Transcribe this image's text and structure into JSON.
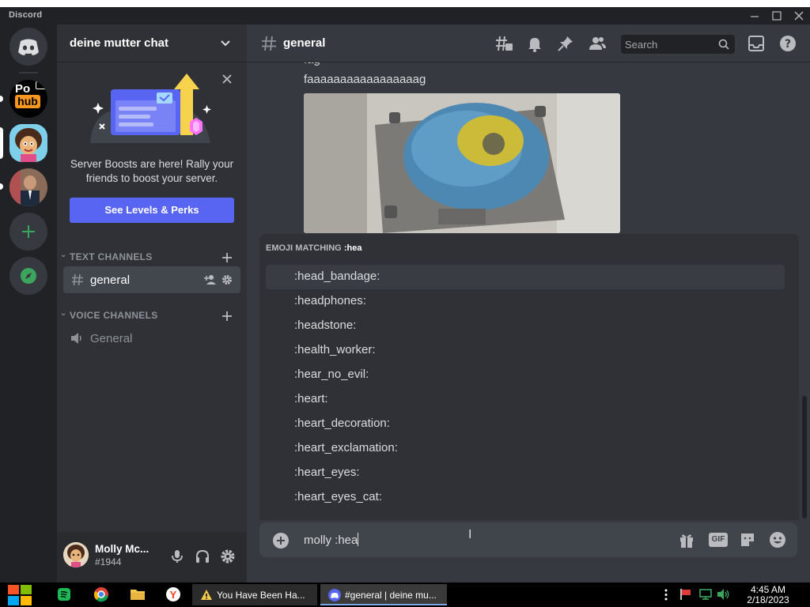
{
  "app": {
    "title": "Discord"
  },
  "server": {
    "name": "deine mutter chat",
    "boost": {
      "text": "Server Boosts are here! Rally your friends to boost your server.",
      "button_label": "See Levels & Perks"
    }
  },
  "rail": {
    "servers": [
      "Discord Home",
      "Po hub",
      "Cartoon server",
      "Portrait server"
    ],
    "hub_text_top": "Po",
    "hub_text_bottom": "hub"
  },
  "categories": {
    "text": "TEXT CHANNELS",
    "voice": "VOICE CHANNELS"
  },
  "channels": {
    "text": [
      {
        "name": "general"
      }
    ],
    "voice": [
      {
        "name": "General"
      }
    ]
  },
  "header": {
    "channel": "general",
    "search_placeholder": "Search"
  },
  "messages": [
    {
      "text": "fag"
    },
    {
      "text": "faaaaaaaaaaaaaaaaag"
    }
  ],
  "emoji_popup": {
    "heading": "EMOJI MATCHING",
    "query": ":hea",
    "items": [
      ":head_bandage:",
      ":headphones:",
      ":headstone:",
      ":health_worker:",
      ":hear_no_evil:",
      ":heart:",
      ":heart_decoration:",
      ":heart_exclamation:",
      ":heart_eyes:",
      ":heart_eyes_cat:"
    ]
  },
  "composer": {
    "value": "molly :hea",
    "gif_label": "GIF"
  },
  "user": {
    "name": "Molly Mc...",
    "tag": "#1944"
  },
  "taskbar": {
    "apps": [
      {
        "label": "You Have Been Ha..."
      },
      {
        "label": "#general | deine mu..."
      }
    ],
    "time": "4:45 AM",
    "date": "2/18/2023"
  },
  "colors": {
    "blurple": "#5865f2",
    "green": "#3ba55d",
    "bg_main": "#36393f",
    "bg_sidebar": "#2f3136",
    "bg_rail": "#202225"
  }
}
